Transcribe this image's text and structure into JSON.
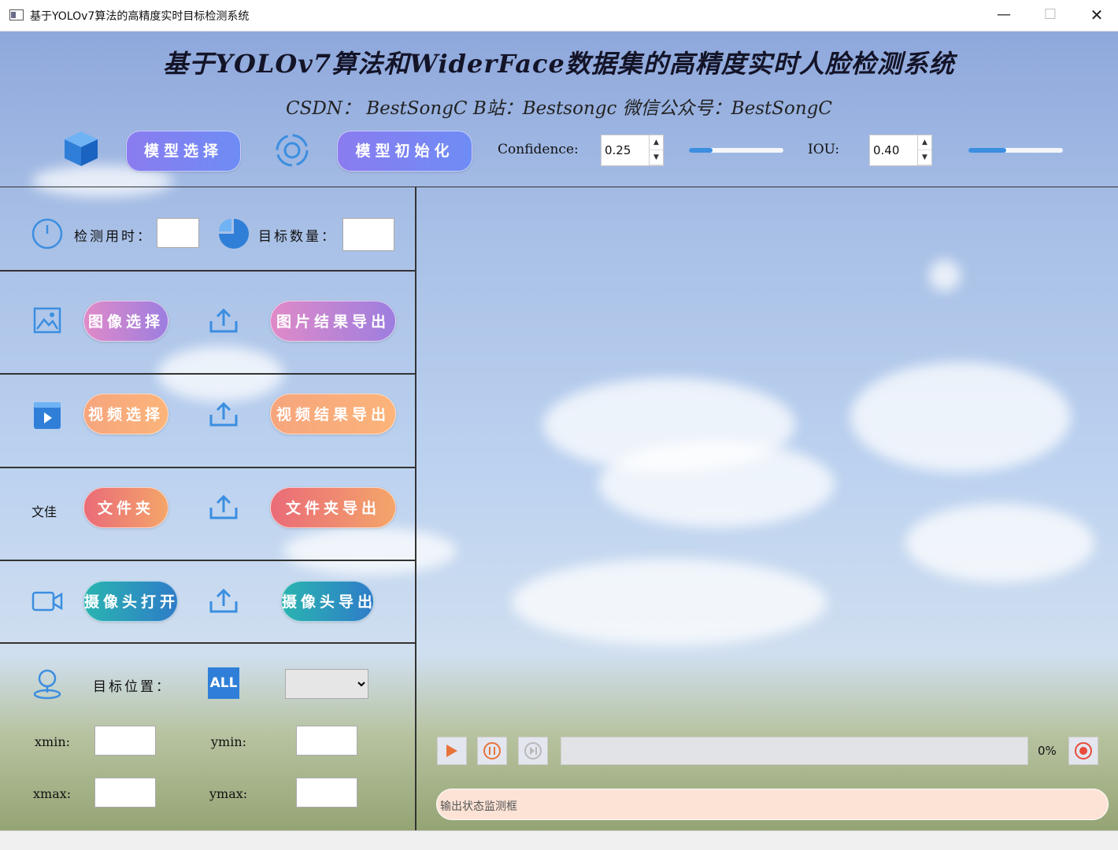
{
  "window": {
    "title": "基于YOLOv7算法的高精度实时目标检测系统",
    "min": "—",
    "max": "☐",
    "close": "✕"
  },
  "header": {
    "title": "基于YOLOv7算法和WiderFace数据集的高精度实时人脸检测系统",
    "subtitle": "CSDN： BestSongC   B站：Bestsongc   微信公众号：BestSongC"
  },
  "toolbar": {
    "model_select": "模型选择",
    "model_init": "模型初始化",
    "confidence_label": "Confidence:",
    "confidence_value": "0.25",
    "confidence_fraction": 0.25,
    "iou_label": "IOU:",
    "iou_value": "0.40",
    "iou_fraction": 0.4
  },
  "stats": {
    "time_label": "检测用时：",
    "count_label": "目标数量："
  },
  "image": {
    "select": "图像选择",
    "export": "图片结果导出"
  },
  "video": {
    "select": "视频选择",
    "export": "视频结果导出"
  },
  "folder": {
    "side_label": "文佳",
    "select": "文件夹",
    "export": "文件夹导出"
  },
  "camera": {
    "open": "摄像头打开",
    "export": "摄像头导出"
  },
  "target": {
    "label": "目标位置：",
    "all_badge": "ALL",
    "xmin_label": "xmin:",
    "ymin_label": "ymin:",
    "xmax_label": "xmax:",
    "ymax_label": "ymax:"
  },
  "player": {
    "progress": "0%",
    "status_placeholder": "输出状态监测框"
  },
  "colors": {
    "accent_blue": "#3b8ee0",
    "icon_blue": "#2f7fd8"
  }
}
